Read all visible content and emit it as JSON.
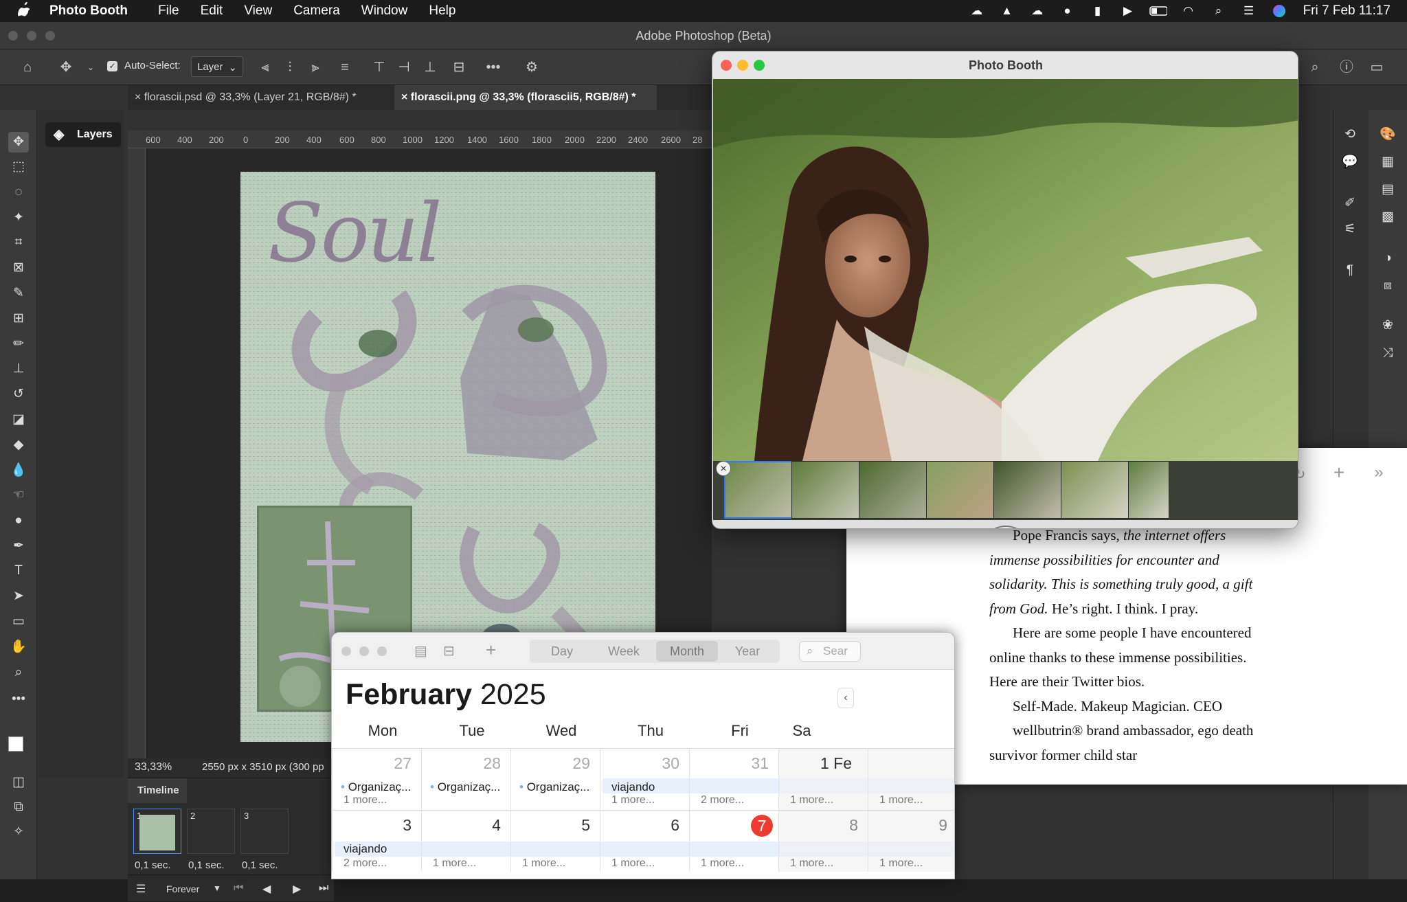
{
  "menubar": {
    "app": "Photo Booth",
    "items": [
      "File",
      "Edit",
      "View",
      "Camera",
      "Window",
      "Help"
    ],
    "clock": "Fri 7 Feb  11:17"
  },
  "photoshop": {
    "window_title": "Adobe Photoshop (Beta)",
    "auto_select_label": "Auto-Select:",
    "auto_select_value": "Layer",
    "tabs": [
      {
        "label": "florascii.psd @ 33,3% (Layer 21, RGB/8#) *"
      },
      {
        "label": "florascii.png @ 33,3% (florascii5, RGB/8#) *"
      }
    ],
    "layers_panel_label": "Layers",
    "ruler_ticks": [
      "600",
      "400",
      "200",
      "0",
      "200",
      "400",
      "600",
      "800",
      "1000",
      "1200",
      "1400",
      "1600",
      "1800",
      "2000",
      "2200",
      "2400",
      "2600",
      "28"
    ],
    "canvas_text": "Soul",
    "zoom": "33,33%",
    "doc_info": "2550 px x 3510 px (300 pp",
    "timeline": {
      "title": "Timeline",
      "frames": [
        {
          "num": "1",
          "time": "0,1 sec."
        },
        {
          "num": "2",
          "time": "0,1 sec."
        },
        {
          "num": "3",
          "time": "0,1 sec."
        }
      ],
      "loop": "Forever"
    }
  },
  "photobooth": {
    "title": "Photo Booth",
    "thumbnail_count": 7
  },
  "book": {
    "paragraphs": [
      {
        "plain": "Pope Francis says, ",
        "italic": "the internet offers immense possibilities for encounter and solidarity. This is something truly good, a gift from God.",
        "after": " He’s right. I think. I pray."
      },
      {
        "plain": "Here are some people I have encountered online thanks to these immense possibilities. Here are their Twitter bios."
      },
      {
        "plain": "Self-Made. Makeup Magician. CEO"
      },
      {
        "plain": "wellbutrin® brand ambassador, ego death survivor former child star"
      }
    ]
  },
  "calendar": {
    "views": [
      "Day",
      "Week",
      "Month",
      "Year"
    ],
    "selected_view": "Month",
    "search_placeholder": "Sear",
    "month": "February",
    "year": "2025",
    "weekdays": [
      "Mon",
      "Tue",
      "Wed",
      "Thu",
      "Fri",
      "Sa"
    ],
    "week1": [
      {
        "day": "27",
        "event": "Organizaç...",
        "more": "1 more..."
      },
      {
        "day": "28",
        "event": "Organizaç...",
        "more": ""
      },
      {
        "day": "29",
        "event": "Organizaç...",
        "more": ""
      },
      {
        "day": "30",
        "event": "viajando",
        "more": "1 more..."
      },
      {
        "day": "31",
        "event": "",
        "more": "2 more..."
      },
      {
        "day": "1 Fe",
        "event": "",
        "more": "1 more..."
      },
      {
        "day": "",
        "event": "",
        "more": "1 more..."
      }
    ],
    "week2": [
      {
        "day": "3",
        "event": "viajando",
        "more": "2 more..."
      },
      {
        "day": "4",
        "event": "",
        "more": "1 more..."
      },
      {
        "day": "5",
        "event": "",
        "more": "1 more..."
      },
      {
        "day": "6",
        "event": "",
        "more": "1 more..."
      },
      {
        "day": "7",
        "event": "",
        "more": "1 more...",
        "today": true
      },
      {
        "day": "8",
        "event": "",
        "more": "1 more..."
      },
      {
        "day": "9",
        "event": "",
        "more": "1 more..."
      }
    ]
  }
}
